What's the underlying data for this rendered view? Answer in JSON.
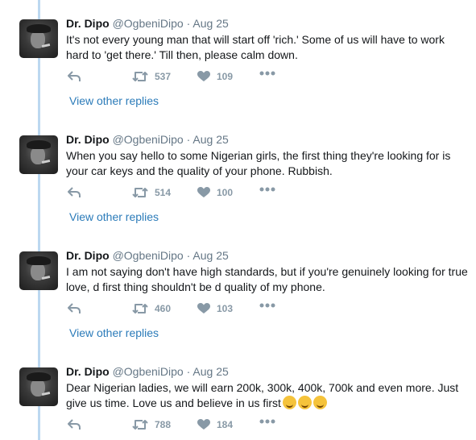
{
  "tweets": [
    {
      "name": "Dr. Dipo",
      "handle": "@OgbeniDipo",
      "separator": "·",
      "date": "Aug 25",
      "text": "It's not every young man that will start off 'rich.' Some of us will have to work hard to 'get there.' Till then, please calm down.",
      "retweets": "537",
      "likes": "109",
      "view_replies": "View other replies"
    },
    {
      "name": "Dr. Dipo",
      "handle": "@OgbeniDipo",
      "separator": "·",
      "date": "Aug 25",
      "text": "When you say hello to some Nigerian girls, the first thing they're looking for is your car keys and the quality of your phone. Rubbish.",
      "retweets": "514",
      "likes": "100",
      "view_replies": "View other replies"
    },
    {
      "name": "Dr. Dipo",
      "handle": "@OgbeniDipo",
      "separator": "·",
      "date": "Aug 25",
      "text": "I am not saying don't have high standards, but if you're genuinely looking for true love, d first thing shouldn't be d quality of my phone.",
      "retweets": "460",
      "likes": "103",
      "view_replies": "View other replies"
    },
    {
      "name": "Dr. Dipo",
      "handle": "@OgbeniDipo",
      "separator": "·",
      "date": "Aug 25",
      "text": "Dear Nigerian ladies, we will earn 200k, 300k, 400k, 700k and even more. Just give us time. Love us and believe in us first",
      "emoji": "smiling-face-emoji x3",
      "retweets": "788",
      "likes": "184"
    }
  ],
  "icons": {
    "reply": "reply-icon",
    "retweet": "retweet-icon",
    "like": "heart-icon",
    "more": "more-dots-icon"
  },
  "colors": {
    "link": "#2b7bb9",
    "muted": "#657786",
    "icon": "#8899a6",
    "thread_line": "#bcd8f0"
  }
}
